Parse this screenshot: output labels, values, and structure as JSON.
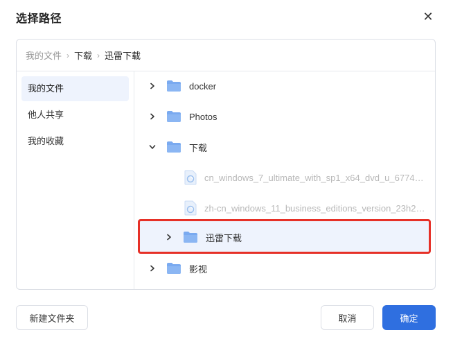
{
  "dialog": {
    "title": "选择路径",
    "close_icon": "close-icon"
  },
  "breadcrumb": [
    "我的文件",
    "下载",
    "迅雷下载"
  ],
  "sidebar": {
    "items": [
      {
        "label": "我的文件",
        "active": true
      },
      {
        "label": "他人共享",
        "active": false
      },
      {
        "label": "我的收藏",
        "active": false
      }
    ]
  },
  "tree": {
    "rows": [
      {
        "name": "docker",
        "type": "folder",
        "expand": "collapsed"
      },
      {
        "name": "Photos",
        "type": "folder",
        "expand": "collapsed"
      },
      {
        "name": "下载",
        "type": "folder",
        "expand": "expanded"
      },
      {
        "name": "cn_windows_7_ultimate_with_sp1_x64_dvd_u_677408....",
        "type": "file"
      },
      {
        "name": "zh-cn_windows_11_business_editions_version_23h2_...",
        "type": "file"
      },
      {
        "name": "迅雷下载",
        "type": "folder",
        "expand": "collapsed",
        "selected": true
      },
      {
        "name": "影视",
        "type": "folder",
        "expand": "collapsed"
      }
    ]
  },
  "footer": {
    "new_folder": "新建文件夹",
    "cancel": "取消",
    "confirm": "确定"
  },
  "colors": {
    "primary": "#2f6fe0",
    "highlight_border": "#e63027",
    "folder": "#7aaaf0",
    "selected_bg": "#eef3fd"
  }
}
